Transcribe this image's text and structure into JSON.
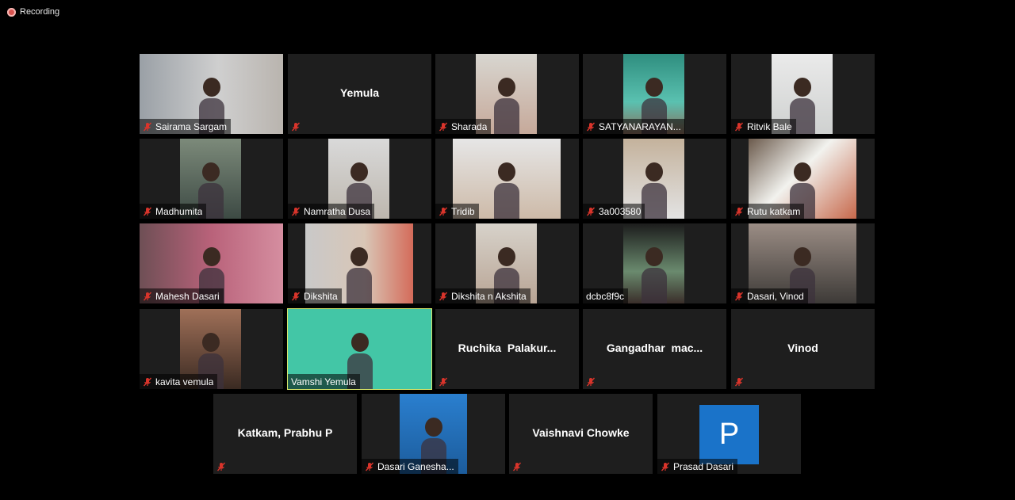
{
  "recording": {
    "label": "Recording"
  },
  "colors": {
    "tile_bg": "#1e1e1e",
    "active_border": "#d6e66b",
    "mute_red": "#d9342b",
    "avatar_blue": "#1a73c9"
  },
  "participants": [
    {
      "name": "Sairama Sargam",
      "video": true,
      "muted": true
    },
    {
      "name": "Yemula",
      "video": false,
      "muted": true
    },
    {
      "name": "Sharada",
      "video": true,
      "muted": true
    },
    {
      "name": "SATYANARAYAN...",
      "video": true,
      "muted": true
    },
    {
      "name": "Ritvik Bale",
      "video": true,
      "muted": true
    },
    {
      "name": "Madhumita",
      "video": true,
      "muted": true
    },
    {
      "name": "Namratha Dusa",
      "video": true,
      "muted": true
    },
    {
      "name": "Tridib",
      "video": true,
      "muted": true
    },
    {
      "name": "3a003580",
      "video": true,
      "muted": true
    },
    {
      "name": "Rutu katkam",
      "video": true,
      "muted": true
    },
    {
      "name": "Mahesh Dasari",
      "video": true,
      "muted": true
    },
    {
      "name": "Dikshita",
      "video": true,
      "muted": true
    },
    {
      "name": "Dikshita n Akshita",
      "video": true,
      "muted": true
    },
    {
      "name": "dcbc8f9c",
      "video": true,
      "muted": false
    },
    {
      "name": "Dasari, Vinod",
      "video": true,
      "muted": true
    },
    {
      "name": "kavita vemula",
      "video": true,
      "muted": true
    },
    {
      "name": "Vamshi Yemula",
      "video": true,
      "muted": false,
      "active_speaker": true
    },
    {
      "name": "Ruchika  Palakur...",
      "video": false,
      "muted": true
    },
    {
      "name": "Gangadhar  mac...",
      "video": false,
      "muted": true
    },
    {
      "name": "Vinod",
      "video": false,
      "muted": true
    },
    {
      "name": "Katkam, Prabhu P",
      "video": false,
      "muted": true
    },
    {
      "name": "Dasari Ganesha...",
      "video": true,
      "muted": true
    },
    {
      "name": "Vaishnavi Chowke",
      "video": false,
      "muted": true
    },
    {
      "name": "Prasad Dasari",
      "video": false,
      "muted": true,
      "avatar_letter": "P"
    }
  ]
}
